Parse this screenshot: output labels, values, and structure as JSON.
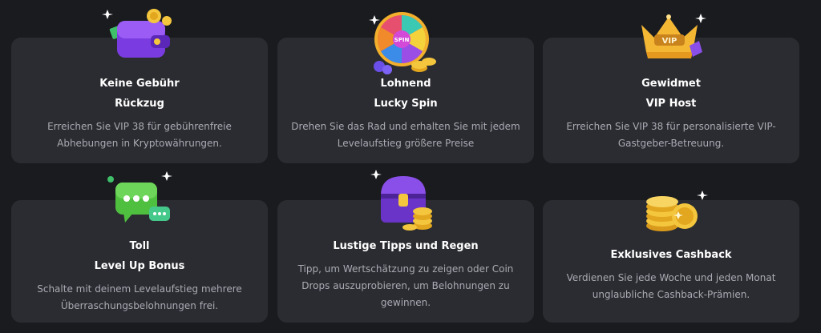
{
  "cards": [
    {
      "icon": "wallet-icon",
      "title_1": "Keine Gebühr",
      "title_2": "Rückzug",
      "desc": "Erreichen Sie VIP 38 für gebührenfreie Abhebungen in Kryptowährungen."
    },
    {
      "icon": "lucky-wheel-icon",
      "wheel_label": "SPIN",
      "title_1": "Lohnend",
      "title_2": "Lucky Spin",
      "desc": "Drehen Sie das Rad und erhalten Sie mit jedem Levelaufstieg größere Preise"
    },
    {
      "icon": "vip-crown-icon",
      "crown_label": "VIP",
      "title_1": "Gewidmet",
      "title_2": "VIP Host",
      "desc": "Erreichen Sie VIP 38 für personalisierte VIP-Gastgeber-Betreuung."
    },
    {
      "icon": "chat-bubbles-icon",
      "title_1": "Toll",
      "title_2": "Level Up Bonus",
      "desc": "Schalte mit deinem Levelaufstieg mehrere Überraschungsbelohnungen frei."
    },
    {
      "icon": "treasure-chest-icon",
      "title_1": "Lustige Tipps und Regen",
      "desc": "Tipp, um Wertschätzung zu zeigen oder Coin Drops auszuprobieren, um Belohnungen zu gewinnen."
    },
    {
      "icon": "coin-stack-icon",
      "title_1": "Exklusives Cashback",
      "desc": "Verdienen Sie jede Woche und jeden Monat unglaubliche Cashback-Prämien."
    }
  ],
  "colors": {
    "background": "#1a1b1f",
    "card": "#2b2c31",
    "title": "#ffffff",
    "text": "#a9abb4"
  }
}
